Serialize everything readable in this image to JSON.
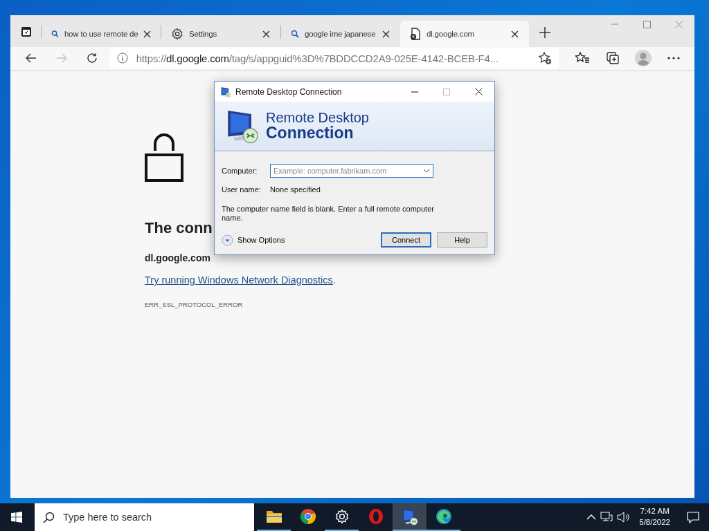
{
  "browser": {
    "tabs": [
      {
        "kind": "search",
        "title": "how to use remote de",
        "selected": false
      },
      {
        "kind": "settings",
        "title": "Settings",
        "selected": false
      },
      {
        "kind": "search",
        "title": "google ime japanese",
        "selected": false
      },
      {
        "kind": "error",
        "title": "dl.google.com",
        "selected": true
      }
    ],
    "address_bar": {
      "scheme": "https://",
      "host": "dl.google.com",
      "path": "/tag/s/appguid%3D%7BDDCCD2A9-025E-4142-BCEB-F4..."
    },
    "page": {
      "heading": "The conn",
      "host": "dl.google.com",
      "diagnostics_link": "Try running Windows Network Diagnostics",
      "link_suffix": ".",
      "error_code": "ERR_SSL_PROTOCOL_ERROR"
    }
  },
  "dialog": {
    "title": "Remote Desktop Connection",
    "banner_line1": "Remote Desktop",
    "banner_line2": "Connection",
    "computer_label": "Computer:",
    "computer_placeholder": "Example: computer.fabrikam.com",
    "user_label": "User name:",
    "user_value": "None specified",
    "message": "The computer name field is blank. Enter a full remote computer name.",
    "show_options": "Show Options",
    "buttons": [
      "Connect",
      "Help"
    ]
  },
  "taskbar": {
    "search_placeholder": "Type here to search",
    "apps": [
      {
        "kind": "files",
        "running": true,
        "selected": false
      },
      {
        "kind": "chrome",
        "running": false,
        "selected": false
      },
      {
        "kind": "settings",
        "running": true,
        "selected": false
      },
      {
        "kind": "opera",
        "running": false,
        "selected": false
      },
      {
        "kind": "rdp",
        "running": true,
        "selected": true
      },
      {
        "kind": "edge",
        "running": true,
        "selected": false
      }
    ],
    "time": "7:42 AM",
    "date": "5/8/2022"
  }
}
